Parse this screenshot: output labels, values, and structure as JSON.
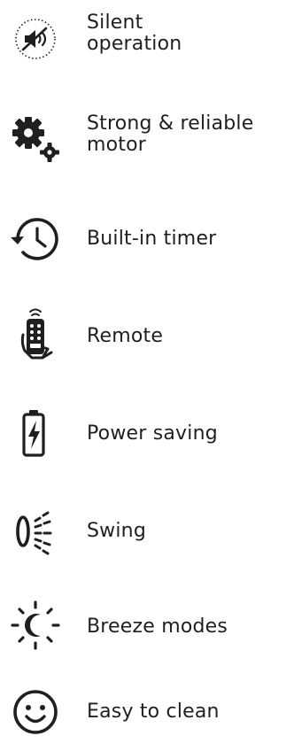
{
  "features": [
    {
      "icon": "silent-speaker-icon",
      "label_line1": "Silent",
      "label_line2": "operation"
    },
    {
      "icon": "gears-icon",
      "label_line1": "Strong & reliable",
      "label_line2": "motor"
    },
    {
      "icon": "clock-timer-icon",
      "label": "Built-in timer"
    },
    {
      "icon": "remote-control-icon",
      "label": "Remote"
    },
    {
      "icon": "battery-power-icon",
      "label": "Power saving"
    },
    {
      "icon": "swing-icon",
      "label": "Swing"
    },
    {
      "icon": "breeze-moon-icon",
      "label": "Breeze modes"
    },
    {
      "icon": "smiley-face-icon",
      "label": "Easy to clean"
    }
  ],
  "colors": {
    "icon": "#1f1f1f",
    "text": "#1f1f1f",
    "background": "#ffffff"
  }
}
